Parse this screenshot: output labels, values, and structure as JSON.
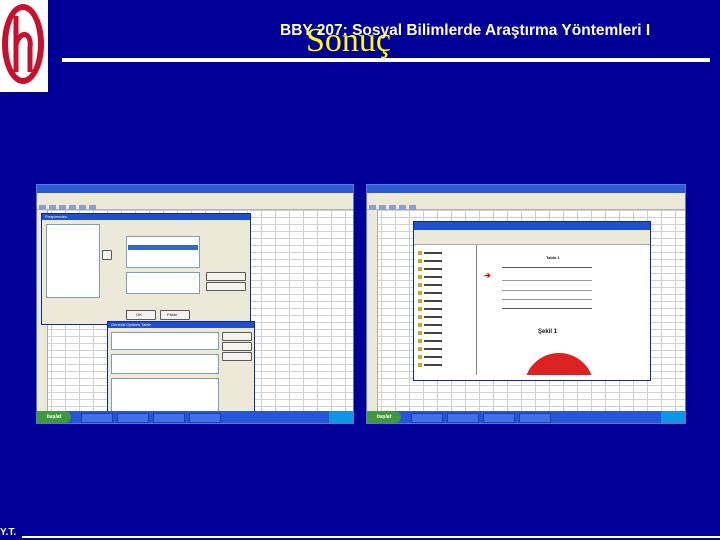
{
  "slide": {
    "course_header": "BBY 207: Sosyal Bilimlerde Araştırma Yöntemleri I",
    "title": "Sonuç",
    "initials": "Y.T."
  },
  "colors": {
    "background": "#000099",
    "title": "#ffff00",
    "header": "#ffffff",
    "logo_red": "#c8102e"
  },
  "screenshot_left": {
    "dialog_title": "Frequencies",
    "dialog_button_ok": "OK",
    "dialog_button_paste": "Paste",
    "dialog_button_reset": "Reset",
    "dialog_button_cancel": "Cancel",
    "dialog_button_help": "Help",
    "subdialog_title": "General Options Table",
    "start_label": "başlat"
  },
  "screenshot_right": {
    "output_heading": "Tablo 1",
    "chart_caption": "Şekil 1",
    "start_label": "başlat"
  }
}
